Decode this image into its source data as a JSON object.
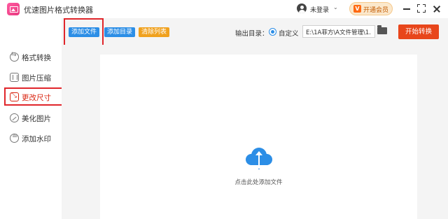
{
  "app": {
    "title": "优速图片格式转换器"
  },
  "header": {
    "login_label": "未登录",
    "login_chevron": "⌄",
    "vip_icon": "V",
    "vip_label": "开通会员"
  },
  "sidebar": {
    "items": [
      {
        "label": "格式转换",
        "icon": "format-convert-icon",
        "active": false
      },
      {
        "label": "图片压缩",
        "icon": "compress-icon",
        "active": false
      },
      {
        "label": "更改尺寸",
        "icon": "resize-icon",
        "active": true
      },
      {
        "label": "美化图片",
        "icon": "beautify-icon",
        "active": false
      },
      {
        "label": "添加水印",
        "icon": "watermark-icon",
        "active": false
      }
    ]
  },
  "toolbar": {
    "add_file_label": "添加文件",
    "add_dir_label": "添加目录",
    "clear_list_label": "清除列表",
    "output_dir_label": "输出目录：",
    "custom_option_label": "自定义",
    "output_path": "E:\\1A菲方\\A文件管理\\1.",
    "start_label": "开始转换"
  },
  "main": {
    "drop_hint": "点击此处添加文件"
  },
  "colors": {
    "accent_blue": "#2c8ee6",
    "clear_orange": "#f0a11e",
    "start_red": "#e8461b",
    "active_red": "#d9230f",
    "highlight_box": "#e0262b"
  }
}
